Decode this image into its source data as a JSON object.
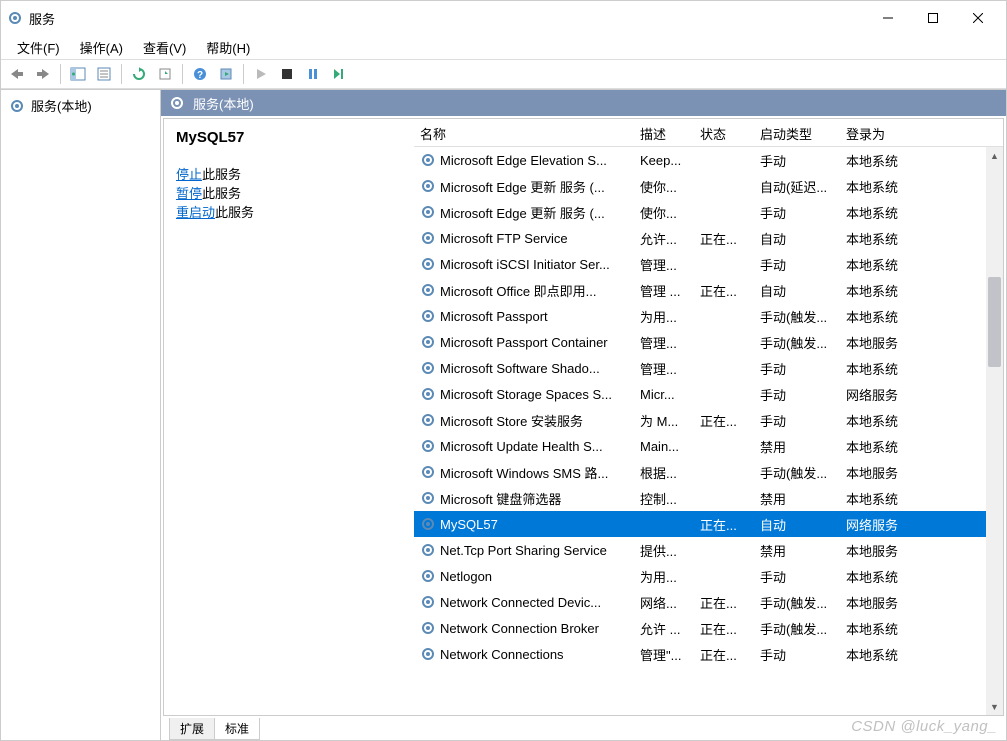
{
  "title": "服务",
  "menus": [
    "文件(F)",
    "操作(A)",
    "查看(V)",
    "帮助(H)"
  ],
  "leftnode": "服务(本地)",
  "rightheader": "服务(本地)",
  "selected_service": "MySQL57",
  "action_links": {
    "stop": "停止",
    "pause": "暂停",
    "restart": "重启动",
    "suffix": "此服务"
  },
  "columns": {
    "name": "名称",
    "desc": "描述",
    "status": "状态",
    "start": "启动类型",
    "logon": "登录为"
  },
  "tabs": {
    "extended": "扩展",
    "standard": "标准"
  },
  "watermark": "CSDN @luck_yang_",
  "rows": [
    {
      "name": "Microsoft Edge Elevation S...",
      "desc": "Keep...",
      "status": "",
      "start": "手动",
      "logon": "本地系统"
    },
    {
      "name": "Microsoft Edge 更新 服务 (...",
      "desc": "使你...",
      "status": "",
      "start": "自动(延迟...",
      "logon": "本地系统"
    },
    {
      "name": "Microsoft Edge 更新 服务 (...",
      "desc": "使你...",
      "status": "",
      "start": "手动",
      "logon": "本地系统"
    },
    {
      "name": "Microsoft FTP Service",
      "desc": "允许...",
      "status": "正在...",
      "start": "自动",
      "logon": "本地系统"
    },
    {
      "name": "Microsoft iSCSI Initiator Ser...",
      "desc": "管理...",
      "status": "",
      "start": "手动",
      "logon": "本地系统"
    },
    {
      "name": "Microsoft Office 即点即用...",
      "desc": "管理 ...",
      "status": "正在...",
      "start": "自动",
      "logon": "本地系统"
    },
    {
      "name": "Microsoft Passport",
      "desc": "为用...",
      "status": "",
      "start": "手动(触发...",
      "logon": "本地系统"
    },
    {
      "name": "Microsoft Passport Container",
      "desc": "管理...",
      "status": "",
      "start": "手动(触发...",
      "logon": "本地服务"
    },
    {
      "name": "Microsoft Software Shado...",
      "desc": "管理...",
      "status": "",
      "start": "手动",
      "logon": "本地系统"
    },
    {
      "name": "Microsoft Storage Spaces S...",
      "desc": "Micr...",
      "status": "",
      "start": "手动",
      "logon": "网络服务"
    },
    {
      "name": "Microsoft Store 安装服务",
      "desc": "为 M...",
      "status": "正在...",
      "start": "手动",
      "logon": "本地系统"
    },
    {
      "name": "Microsoft Update Health S...",
      "desc": "Main...",
      "status": "",
      "start": "禁用",
      "logon": "本地系统"
    },
    {
      "name": "Microsoft Windows SMS 路...",
      "desc": "根据...",
      "status": "",
      "start": "手动(触发...",
      "logon": "本地服务"
    },
    {
      "name": "Microsoft 键盘筛选器",
      "desc": "控制...",
      "status": "",
      "start": "禁用",
      "logon": "本地系统"
    },
    {
      "name": "MySQL57",
      "desc": "",
      "status": "正在...",
      "start": "自动",
      "logon": "网络服务",
      "selected": true
    },
    {
      "name": "Net.Tcp Port Sharing Service",
      "desc": "提供...",
      "status": "",
      "start": "禁用",
      "logon": "本地服务"
    },
    {
      "name": "Netlogon",
      "desc": "为用...",
      "status": "",
      "start": "手动",
      "logon": "本地系统"
    },
    {
      "name": "Network Connected Devic...",
      "desc": "网络...",
      "status": "正在...",
      "start": "手动(触发...",
      "logon": "本地服务"
    },
    {
      "name": "Network Connection Broker",
      "desc": "允许 ...",
      "status": "正在...",
      "start": "手动(触发...",
      "logon": "本地系统"
    },
    {
      "name": "Network Connections",
      "desc": "管理\"...",
      "status": "正在...",
      "start": "手动",
      "logon": "本地系统"
    }
  ]
}
